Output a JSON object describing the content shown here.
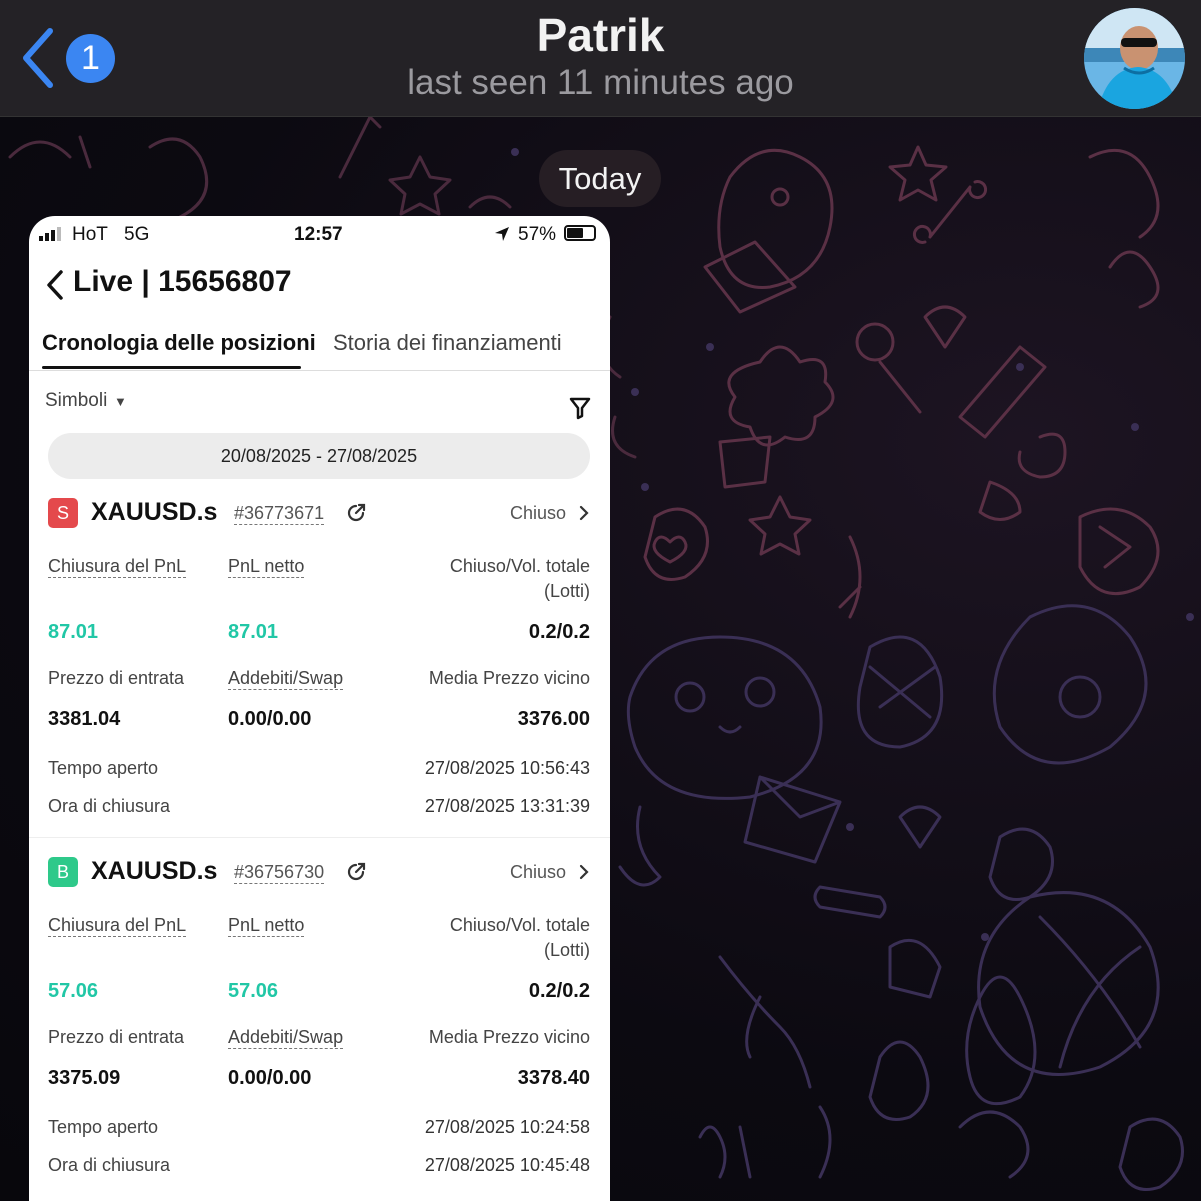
{
  "header": {
    "unread_count": "1",
    "contact_name": "Patrik",
    "last_seen": "last seen 11 minutes ago"
  },
  "chat": {
    "date_separator": "Today"
  },
  "photo": {
    "statusbar": {
      "carrier": "HoT",
      "network": "5G",
      "time": "12:57",
      "battery": "57%"
    },
    "nav_title": "Live | 15656807",
    "tabs": [
      {
        "label": "Cronologia delle posizioni",
        "active": true
      },
      {
        "label": "Storia dei finanziamenti",
        "active": false
      }
    ],
    "filter_label": "Simboli",
    "date_range": "20/08/2025 - 27/08/2025",
    "positions": [
      {
        "side": "S",
        "symbol": "XAUUSD.s",
        "ticket": "#36773671",
        "status": "Chiuso",
        "labels": {
          "close_pnl": "Chiusura del PnL",
          "net_pnl": "PnL netto",
          "closed_vol_1": "Chiuso/Vol. totale",
          "closed_vol_2": "(Lotti)",
          "entry_price": "Prezzo di entrata",
          "charges": "Addebiti/Swap",
          "avg_close": "Media Prezzo vicino",
          "open_time": "Tempo aperto",
          "close_time": "Ora di chiusura"
        },
        "close_pnl": "87.01",
        "net_pnl": "87.01",
        "closed_vol": "0.2/0.2",
        "entry_price": "3381.04",
        "charges": "0.00/0.00",
        "avg_close": "3376.00",
        "open_time": "27/08/2025 10:56:43",
        "close_time": "27/08/2025 13:31:39"
      },
      {
        "side": "B",
        "symbol": "XAUUSD.s",
        "ticket": "#36756730",
        "status": "Chiuso",
        "labels": {
          "close_pnl": "Chiusura del PnL",
          "net_pnl": "PnL netto",
          "closed_vol_1": "Chiuso/Vol. totale",
          "closed_vol_2": "(Lotti)",
          "entry_price": "Prezzo di entrata",
          "charges": "Addebiti/Swap",
          "avg_close": "Media Prezzo vicino",
          "open_time": "Tempo aperto",
          "close_time": "Ora di chiusura"
        },
        "close_pnl": "57.06",
        "net_pnl": "57.06",
        "closed_vol": "0.2/0.2",
        "entry_price": "3375.09",
        "charges": "0.00/0.00",
        "avg_close": "3378.40",
        "open_time": "27/08/2025 10:24:58",
        "close_time": "27/08/2025 10:45:48"
      }
    ]
  },
  "colors": {
    "header_bg": "#242226",
    "accent_blue": "#3b86f2",
    "profit_green": "#21c7a6",
    "sell_red": "#e4494c",
    "buy_green": "#2ec98a"
  },
  "icons": [
    "back-chevron-icon",
    "avatar-photo",
    "signal-icon",
    "location-arrow-icon",
    "battery-icon",
    "filter-icon",
    "share-icon",
    "chevron-right-icon"
  ]
}
